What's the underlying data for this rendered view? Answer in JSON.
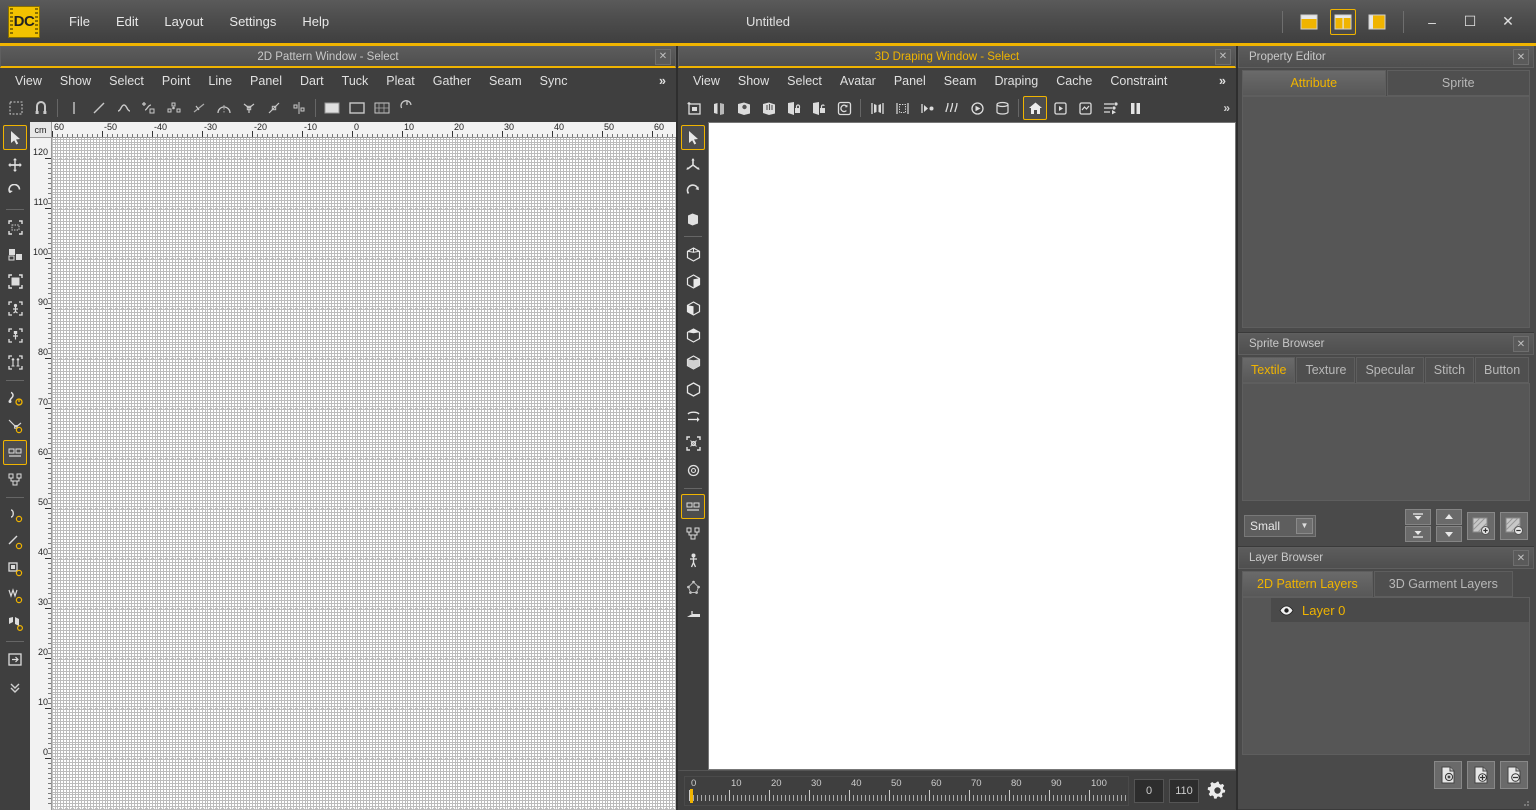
{
  "app": {
    "logo": "DC",
    "title": "Untitled",
    "menu": [
      "File",
      "Edit",
      "Layout",
      "Settings",
      "Help"
    ],
    "layout_buttons": [
      {
        "name": "layout-single-icon",
        "active": false
      },
      {
        "name": "layout-split-icon",
        "active": true
      },
      {
        "name": "layout-right-icon",
        "active": false
      }
    ],
    "window_controls": [
      {
        "name": "minimize-button",
        "glyph": "–"
      },
      {
        "name": "maximize-button",
        "glyph": "☐"
      },
      {
        "name": "close-button",
        "glyph": "✕"
      }
    ]
  },
  "pattern2d": {
    "title": "2D Pattern Window - Select",
    "menu": [
      "View",
      "Show",
      "Select",
      "Point",
      "Line",
      "Panel",
      "Dart",
      "Tuck",
      "Pleat",
      "Gather",
      "Seam",
      "Sync"
    ],
    "overflow": "»",
    "ruler": {
      "unit": "cm",
      "h_ticks": [
        "60",
        "-50",
        "-40",
        "-30",
        "-20",
        "-10",
        "0",
        "10",
        "20",
        "30",
        "40",
        "50",
        "60"
      ],
      "v_ticks": [
        "120",
        "110",
        "100",
        "90",
        "80",
        "70",
        "60",
        "50",
        "40",
        "30",
        "20",
        "10",
        "0"
      ]
    },
    "top_tools": [
      "point-tool-icon",
      "edit-point-icon",
      "line-tool-icon",
      "curve-tool-icon",
      "add-point-icon",
      "multi-point-icon",
      "tangent-icon",
      "arc-icon",
      "angle-icon",
      "slope-icon",
      "symmetry-icon",
      "panel-icon",
      "fill-panel-icon",
      "grid-panel-icon",
      "rotate-panel-icon"
    ],
    "side_tools": [
      "select-arrow-icon",
      "move-icon",
      "rotate-icon",
      "select-region-icon",
      "select-panel-icon",
      "select-box-icon",
      "select-inner-icon",
      "select-dart-icon",
      "select-pair-icon",
      "measure-icon",
      "measure-angle-icon",
      "distance-icon",
      "length-icon",
      "circle-measure-icon",
      "curve-measure-icon",
      "fold-measure-icon",
      "export-icon",
      "more-icon"
    ]
  },
  "draping3d": {
    "title": "3D Draping Window - Select",
    "menu": [
      "View",
      "Show",
      "Select",
      "Avatar",
      "Panel",
      "Seam",
      "Draping",
      "Cache",
      "Constraint"
    ],
    "overflow": "»",
    "top_tools": [
      "add-panel-icon",
      "mirror-panel-icon",
      "drop-panel-icon",
      "arrange-panel-icon",
      "lock-panel-icon",
      "unlock-panel-icon",
      "reset-panel-icon",
      "open-seam-icon",
      "mesh-seam-icon",
      "pin-seam-icon",
      "drape-icon",
      "simulate-icon",
      "cache-icon",
      "home-view-icon",
      "play-frame-icon",
      "record-icon",
      "timeline-settings-icon",
      "pause-icon"
    ],
    "side_tools": [
      "select-arrow-icon",
      "move-3d-icon",
      "rotate-3d-icon",
      "scale-3d-icon",
      "view-front-icon",
      "view-back-icon",
      "view-left-icon",
      "view-right-icon",
      "view-top-icon",
      "view-bottom-icon",
      "view-perspective-icon",
      "zoom-fit-icon",
      "zoom-selection-icon",
      "grid-toggle-icon",
      "mesh-toggle-icon",
      "avatar-toggle-icon",
      "particle-icon",
      "floor-icon"
    ],
    "active_tool": "home-view-icon",
    "timeline": {
      "ticks": [
        "0",
        "10",
        "20",
        "30",
        "40",
        "50",
        "60",
        "70",
        "80",
        "90",
        "100",
        "110"
      ],
      "start_value": "0",
      "end_value": "110",
      "settings_icon": "gear-icon"
    }
  },
  "property_editor": {
    "title": "Property Editor",
    "tabs": [
      {
        "label": "Attribute",
        "active": true
      },
      {
        "label": "Sprite",
        "active": false
      }
    ]
  },
  "sprite_browser": {
    "title": "Sprite Browser",
    "tabs": [
      {
        "label": "Textile",
        "active": true
      },
      {
        "label": "Texture",
        "active": false
      },
      {
        "label": "Specular",
        "active": false
      },
      {
        "label": "Stitch",
        "active": false
      },
      {
        "label": "Button",
        "active": false
      }
    ],
    "size_select": "Small",
    "nav_buttons": [
      {
        "name": "first-button",
        "glyph": "▲"
      },
      {
        "name": "last-button",
        "glyph": "▼"
      },
      {
        "name": "up-button",
        "glyph": "▲"
      },
      {
        "name": "down-button",
        "glyph": "▼"
      }
    ],
    "action_buttons": [
      "add-texture-icon",
      "remove-texture-icon"
    ]
  },
  "layer_browser": {
    "title": "Layer Browser",
    "tabs": [
      {
        "label": "2D Pattern Layers",
        "active": true
      },
      {
        "label": "3D Garment Layers",
        "active": false
      }
    ],
    "layers": [
      {
        "name": "Layer 0",
        "visible": true,
        "visibility_icon": "eye-icon"
      }
    ],
    "buttons": [
      "layer-settings-icon",
      "layer-add-icon",
      "layer-remove-icon"
    ]
  },
  "colors": {
    "accent": "#f0b400",
    "panel_bg": "#4a4a4a",
    "window_bg": "#3f3f3f",
    "canvas": "#ffffff"
  }
}
